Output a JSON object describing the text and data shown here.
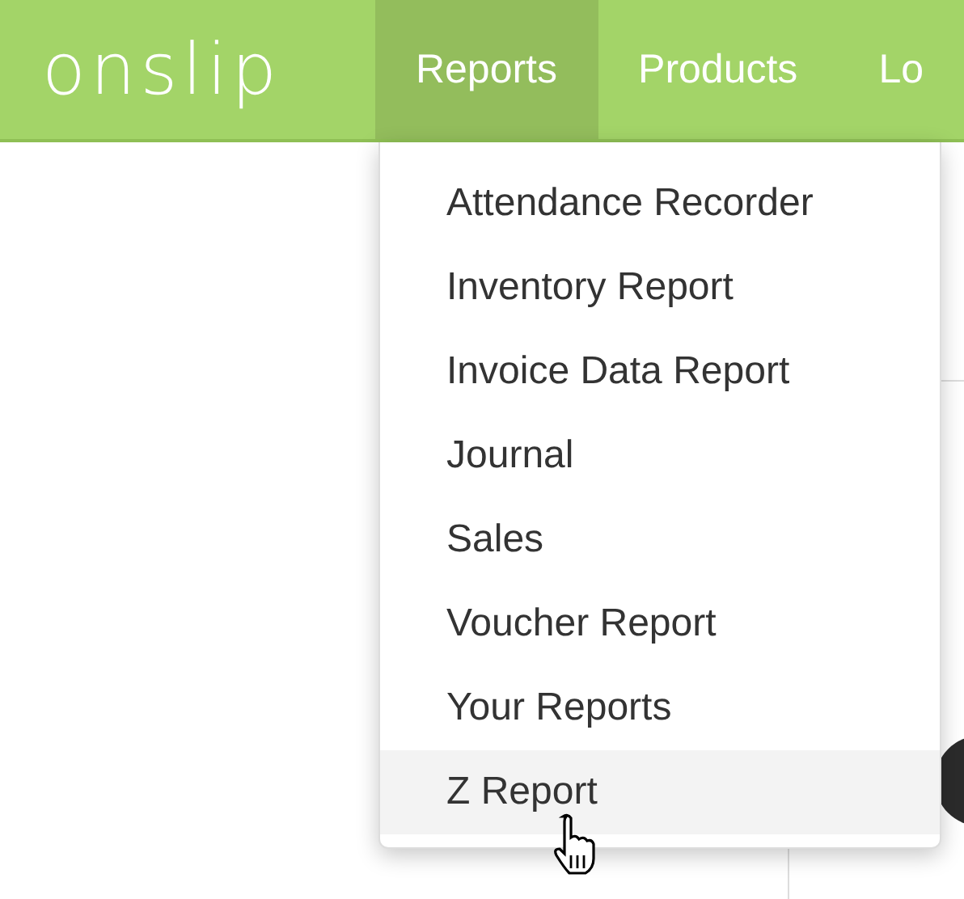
{
  "logo": "onslip",
  "nav": [
    {
      "label": "Reports",
      "selected": true
    },
    {
      "label": "Products",
      "selected": false
    },
    {
      "label": "Lo",
      "selected": false
    }
  ],
  "menu": [
    {
      "label": "Attendance Recorder",
      "selected": false
    },
    {
      "label": "Inventory Report",
      "selected": false
    },
    {
      "label": "Invoice Data Report",
      "selected": false
    },
    {
      "label": "Journal",
      "selected": false
    },
    {
      "label": "Sales",
      "selected": false
    },
    {
      "label": "Voucher Report",
      "selected": false
    },
    {
      "label": "Your Reports",
      "selected": false
    },
    {
      "label": "Z Report",
      "selected": true
    }
  ]
}
